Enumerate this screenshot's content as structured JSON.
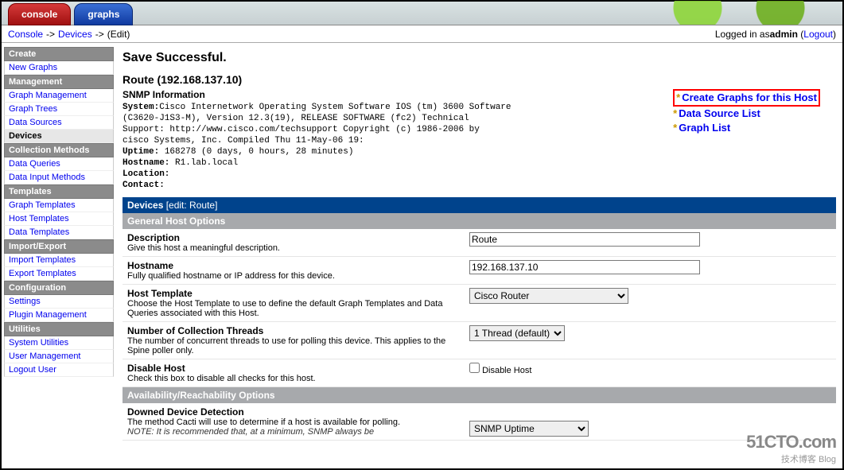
{
  "tabs": {
    "console": "console",
    "graphs": "graphs"
  },
  "breadcrumb": {
    "console": "Console",
    "devices": "Devices",
    "edit": "(Edit)"
  },
  "login": {
    "prefix": "Logged in as ",
    "user": "admin",
    "logout": "Logout"
  },
  "sidebar": {
    "create": "Create",
    "new_graphs": "New Graphs",
    "management": "Management",
    "graph_management": "Graph Management",
    "graph_trees": "Graph Trees",
    "data_sources": "Data Sources",
    "devices": "Devices",
    "collection_methods": "Collection Methods",
    "data_queries": "Data Queries",
    "data_input_methods": "Data Input Methods",
    "templates": "Templates",
    "graph_templates": "Graph Templates",
    "host_templates": "Host Templates",
    "data_templates": "Data Templates",
    "import_export": "Import/Export",
    "import_templates": "Import Templates",
    "export_templates": "Export Templates",
    "configuration": "Configuration",
    "settings": "Settings",
    "plugin_management": "Plugin Management",
    "utilities": "Utilities",
    "system_utilities": "System Utilities",
    "user_management": "User Management",
    "logout_user": "Logout User"
  },
  "content": {
    "save_msg": "Save Successful.",
    "device_title": "Route (192.168.137.10)",
    "snmp_label": "SNMP Information",
    "snmp_text": "System:Cisco Internetwork Operating System Software IOS (tm) 3600 Software\n(C3620-J1S3-M), Version 12.3(19), RELEASE SOFTWARE (fc2) Technical\nSupport: http://www.cisco.com/techsupport Copyright (c) 1986-2006 by\ncisco Systems, Inc. Compiled Thu 11-May-06 19:\nUptime: 168278 (0 days, 0 hours, 28 minutes)\nHostname: R1.lab.local\nLocation:\nContact:",
    "actions": {
      "create_graphs": "Create Graphs for this Host",
      "data_source_list": "Data Source List",
      "graph_list": "Graph List"
    },
    "devices_bar": "Devices",
    "devices_bar_sub": " [edit: Route]",
    "general_host_options": "General Host Options",
    "desc_title": "Description",
    "desc_help": "Give this host a meaningful description.",
    "desc_value": "Route",
    "host_title": "Hostname",
    "host_help": "Fully qualified hostname or IP address for this device.",
    "host_value": "192.168.137.10",
    "tpl_title": "Host Template",
    "tpl_help": "Choose the Host Template to use to define the default Graph Templates and Data Queries associated with this Host.",
    "tpl_value": "Cisco Router",
    "threads_title": "Number of Collection Threads",
    "threads_help": "The number of concurrent threads to use for polling this device. This applies to the Spine poller only.",
    "threads_value": "1 Thread (default)",
    "disable_title": "Disable Host",
    "disable_help": "Check this box to disable all checks for this host.",
    "disable_label": "Disable Host",
    "avail_bar": "Availability/Reachability Options",
    "downed_title": "Downed Device Detection",
    "downed_help": "The method Cacti will use to determine if a host is available for polling.",
    "downed_note": "NOTE: It is recommended that, at a minimum, SNMP always be",
    "downed_value": "SNMP Uptime"
  },
  "watermark": {
    "big": "51CTO.com",
    "small": "技术博客    Blog"
  }
}
